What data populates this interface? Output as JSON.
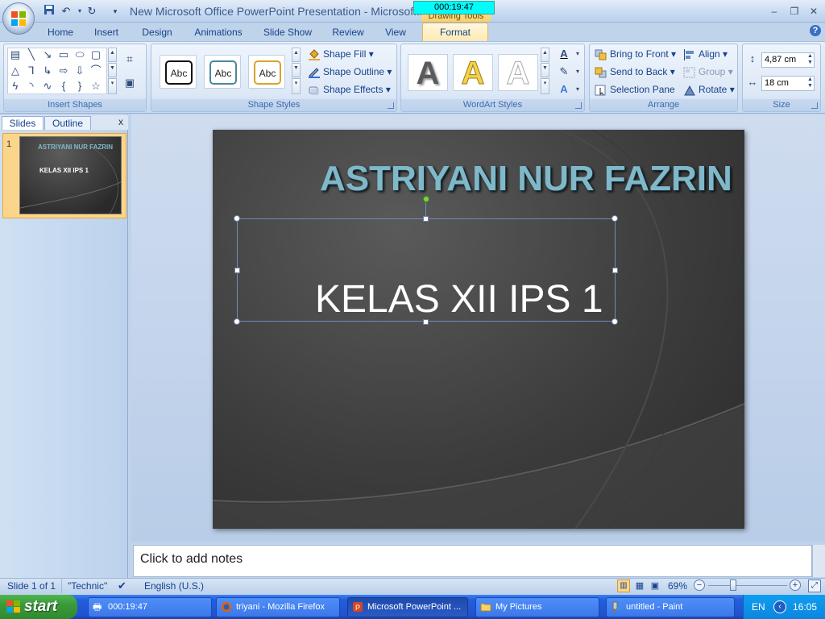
{
  "window": {
    "title": "New Microsoft Office PowerPoint Presentation - Microsof...",
    "contextual_tab_group": "Drawing Tools",
    "timer_overlay": "000:19:47"
  },
  "quick_access": {
    "save_icon": "save-icon",
    "undo_icon": "undo-icon",
    "redo_icon": "redo-icon",
    "customize_icon": "customize-icon"
  },
  "tabs": [
    "Home",
    "Insert",
    "Design",
    "Animations",
    "Slide Show",
    "Review",
    "View",
    "Format"
  ],
  "ribbon": {
    "groups": {
      "insert_shapes": "Insert Shapes",
      "shape_styles": "Shape Styles",
      "wordart_styles": "WordArt Styles",
      "arrange": "Arrange",
      "size": "Size"
    },
    "style_samples": [
      "Abc",
      "Abc",
      "Abc"
    ],
    "shape_fill": "Shape Fill",
    "shape_outline": "Shape Outline",
    "shape_effects": "Shape Effects",
    "bring_to_front": "Bring to Front",
    "send_to_back": "Send to Back",
    "selection_pane": "Selection Pane",
    "align": "Align",
    "group": "Group",
    "rotate": "Rotate",
    "height": "4,87 cm",
    "width": "18 cm",
    "wordart_letters": [
      "A",
      "A",
      "A"
    ]
  },
  "left_pane": {
    "tab_slides": "Slides",
    "tab_outline": "Outline",
    "close": "x",
    "slide_number": "1",
    "thumb_title": "ASTRIYANI NUR FAZRIN",
    "thumb_subtitle": "KELAS XII IPS 1"
  },
  "slide": {
    "title": "ASTRIYANI NUR FAZRIN",
    "subtitle": "KELAS XII IPS 1"
  },
  "notes": {
    "placeholder": "Click to add notes"
  },
  "status": {
    "slide_info": "Slide 1 of 1",
    "theme": "\"Technic\"",
    "language": "English (U.S.)",
    "zoom": "69%"
  },
  "taskbar": {
    "start": "start",
    "items": [
      {
        "label": "000:19:47",
        "active": false
      },
      {
        "label": "triyani - Mozilla Firefox",
        "active": false
      },
      {
        "label": "Microsoft PowerPoint ...",
        "active": true
      },
      {
        "label": "My Pictures",
        "active": false
      },
      {
        "label": "untitled - Paint",
        "active": false
      }
    ],
    "language": "EN",
    "clock": "16:05"
  },
  "colors": {
    "ribbon_bg": "#dde8f6",
    "format_tab": "#fde9b0",
    "slide_title": "#7fb8c9",
    "taskbar": "#245edc",
    "start_button": "#3a9a3a"
  }
}
